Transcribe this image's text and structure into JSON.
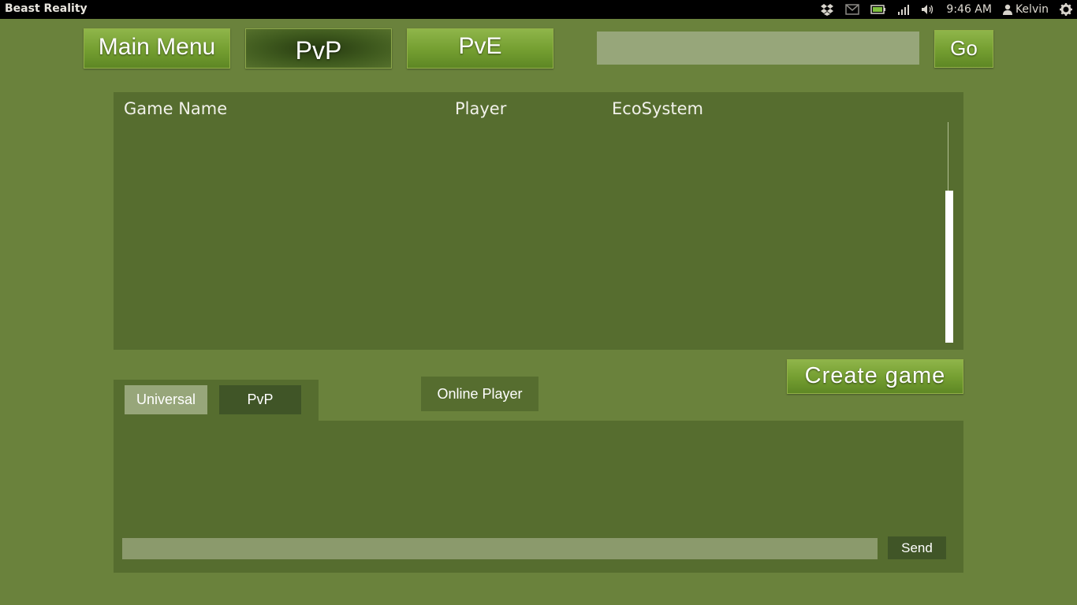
{
  "topbar": {
    "app_title": "Beast Reality",
    "clock": "9:46 AM",
    "user": "Kelvin",
    "icons": [
      "dropbox-icon",
      "mail-icon",
      "battery-icon",
      "signal-icon",
      "volume-icon",
      "user-icon",
      "gear-icon"
    ]
  },
  "nav": {
    "main_menu": "Main Menu",
    "pvp": "PvP",
    "pve": "PvE",
    "go": "Go",
    "search_value": ""
  },
  "games_table": {
    "columns": [
      "Game Name",
      "Player",
      "EcoSystem"
    ],
    "rows": []
  },
  "create_game": "Create game",
  "chat": {
    "tabs": [
      "Universal",
      "PvP"
    ],
    "active_tab": "Universal",
    "online_player": "Online Player",
    "input_value": "",
    "send": "Send"
  },
  "colors": {
    "background": "#6a823c",
    "panel": "#566d2f",
    "input": "#97a67a",
    "active_tab": "#97a67a",
    "inactive_tab": "#405527"
  }
}
